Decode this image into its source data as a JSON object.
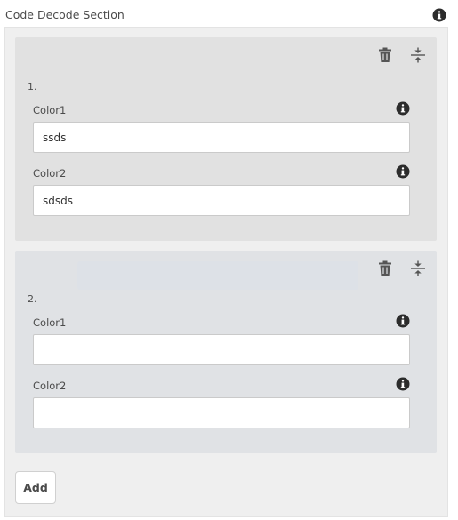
{
  "section": {
    "title": "Code Decode Section",
    "info_icon": "info-icon"
  },
  "items": [
    {
      "number": "1.",
      "fields": [
        {
          "label": "Color1",
          "value": "ssds"
        },
        {
          "label": "Color2",
          "value": "sdsds"
        }
      ],
      "actions": {
        "delete_icon": "trash-icon",
        "reorder_icon": "drag-reorder-icon"
      }
    },
    {
      "number": "2.",
      "fields": [
        {
          "label": "Color1",
          "value": ""
        },
        {
          "label": "Color2",
          "value": ""
        }
      ],
      "actions": {
        "delete_icon": "trash-icon",
        "reorder_icon": "drag-reorder-icon"
      }
    }
  ],
  "add_button": {
    "label": "Add"
  },
  "colors": {
    "container_bg": "#efefef",
    "item_bg": "#e1e1e1",
    "item_active_bg": "#e0e2e5",
    "input_border": "#cacaca",
    "text": "#4b4b4b",
    "icon": "#2c2c2c"
  }
}
